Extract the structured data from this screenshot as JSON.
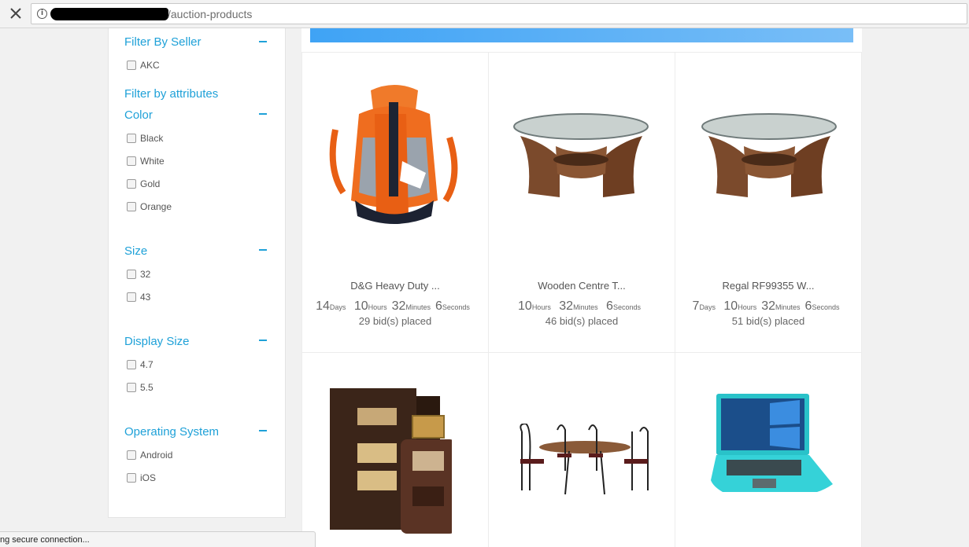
{
  "browser": {
    "url_path": "/auction-products"
  },
  "sidebar": {
    "seller": {
      "heading": "Filter By Seller",
      "options": [
        "AKC"
      ]
    },
    "attributes_heading": "Filter by attributes",
    "color": {
      "heading": "Color",
      "options": [
        "Black",
        "White",
        "Gold",
        "Orange"
      ]
    },
    "size": {
      "heading": "Size",
      "options": [
        "32",
        "43"
      ]
    },
    "display_size": {
      "heading": "Display Size",
      "options": [
        "4.7",
        "5.5"
      ]
    },
    "os": {
      "heading": "Operating System",
      "options": [
        "Android",
        "iOS"
      ]
    }
  },
  "products": [
    {
      "name": "D&G Heavy Duty ...",
      "days": "14",
      "hours": "10",
      "minutes": "32",
      "seconds": "6",
      "bids": "29 bid(s) placed",
      "image": "orange-backpack"
    },
    {
      "name": "Wooden Centre T...",
      "days": "",
      "hours": "10",
      "minutes": "32",
      "seconds": "6",
      "bids": "46 bid(s) placed",
      "image": "glass-centre-table"
    },
    {
      "name": "Regal RF99355 W...",
      "days": "7",
      "hours": "10",
      "minutes": "32",
      "seconds": "6",
      "bids": "51 bid(s) placed",
      "image": "glass-centre-table"
    },
    {
      "name": "",
      "image": "perfume-box"
    },
    {
      "name": "",
      "image": "dining-set"
    },
    {
      "name": "",
      "image": "turquoise-laptop"
    }
  ],
  "timer_units": {
    "days": "Days",
    "hours": "Hours",
    "minutes": "Minutes",
    "seconds": "Seconds"
  },
  "status": {
    "text": "ng secure connection..."
  },
  "colors": {
    "accent": "#1fa1d8",
    "banner": "#3fa3f5"
  }
}
